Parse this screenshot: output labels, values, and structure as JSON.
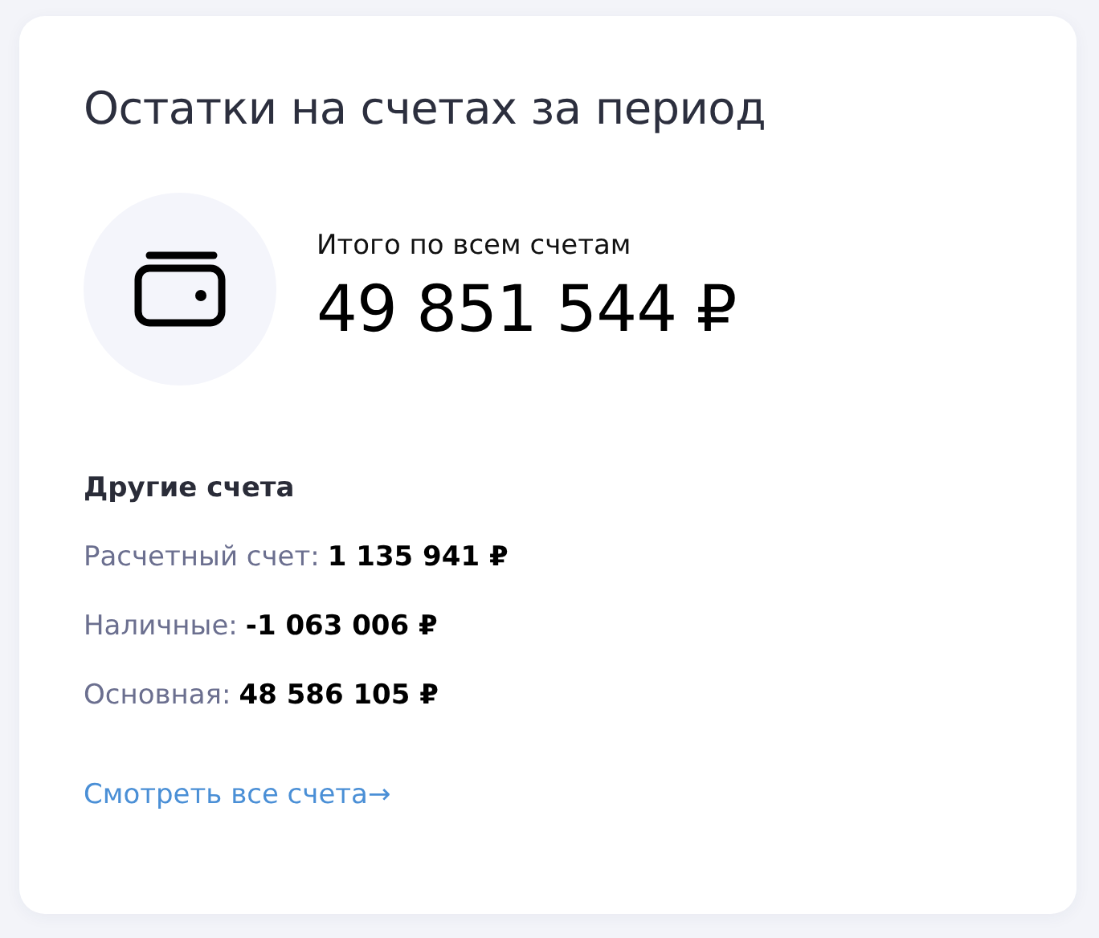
{
  "card": {
    "title": "Остатки на счетах за период",
    "total": {
      "label": "Итого по всем счетам",
      "amount": "49 851 544 ₽"
    },
    "other_heading": "Другие счета",
    "accounts": [
      {
        "label": "Расчетный счет:",
        "amount": "1 135 941 ₽"
      },
      {
        "label": "Наличные:",
        "amount": "-1 063 006 ₽"
      },
      {
        "label": "Основная:",
        "amount": "48 586 105 ₽"
      }
    ],
    "link": "Смотреть все счета→"
  }
}
